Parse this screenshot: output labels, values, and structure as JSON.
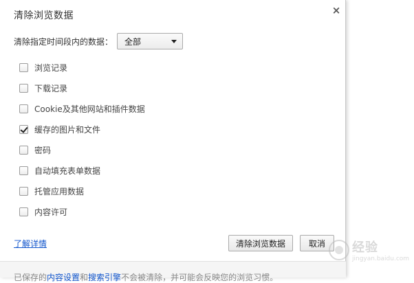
{
  "dialog": {
    "title": "清除浏览数据",
    "close_label": "×"
  },
  "time_range": {
    "label": "清除指定时间段内的数据：",
    "selected": "全部"
  },
  "options": [
    {
      "label": "浏览记录",
      "checked": false
    },
    {
      "label": "下载记录",
      "checked": false
    },
    {
      "label": "Cookie及其他网站和插件数据",
      "checked": false
    },
    {
      "label": "缓存的图片和文件",
      "checked": true
    },
    {
      "label": "密码",
      "checked": false
    },
    {
      "label": "自动填充表单数据",
      "checked": false
    },
    {
      "label": "托管应用数据",
      "checked": false
    },
    {
      "label": "内容许可",
      "checked": false
    }
  ],
  "learn_more": "了解详情",
  "buttons": {
    "clear": "清除浏览数据",
    "cancel": "取消"
  },
  "footer": {
    "prefix": "已保存的",
    "link1": "内容设置",
    "and": "和",
    "link2": "搜索引擎",
    "suffix": "不会被清除，并可能会反映您的浏览习惯。"
  },
  "watermark": {
    "main": "经验",
    "sub": "jingyan.baidu.com"
  },
  "colors": {
    "link": "#1155cc",
    "footer_bg": "#f5f5f5"
  }
}
